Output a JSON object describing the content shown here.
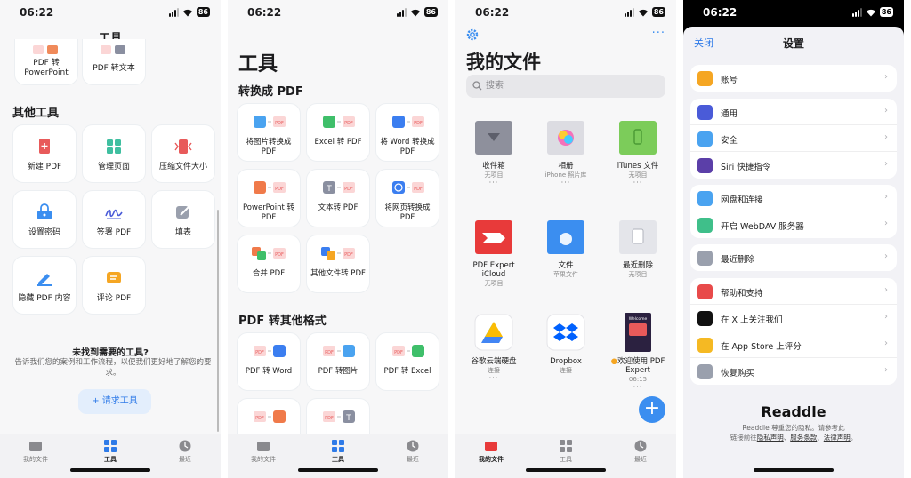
{
  "status": {
    "time": "06:22",
    "battery": "86"
  },
  "tabs": {
    "files": "我的文件",
    "tools": "工具",
    "recent": "最近"
  },
  "panel1": {
    "title": "工具",
    "top_tiles": [
      "PDF 转 PowerPoint",
      "PDF 转文本"
    ],
    "section_title": "其他工具",
    "tools": [
      "新建 PDF",
      "管理页面",
      "压缩文件大小",
      "设置密码",
      "签署 PDF",
      "填表",
      "隐藏 PDF 内容",
      "评论 PDF"
    ],
    "ask_title": "未找到需要的工具?",
    "ask_desc": "告诉我们您的案例和工作流程，以便我们更好地了解您的要求。",
    "request_button": "+ 请求工具"
  },
  "panel2": {
    "title": "工具",
    "section_convert": "转换成 PDF",
    "convert": [
      "将图片转换成 PDF",
      "Excel 转 PDF",
      "将 Word 转换成 PDF",
      "PowerPoint 转 PDF",
      "文本转 PDF",
      "将网页转换成 PDF",
      "合并 PDF",
      "其他文件转 PDF"
    ],
    "section_other": "PDF 转其他格式",
    "export": [
      "PDF 转 Word",
      "PDF 转图片",
      "PDF 转 Excel"
    ]
  },
  "panel3": {
    "title": "我的文件",
    "search_placeholder": "搜索",
    "folders": [
      {
        "name": "收件箱",
        "sub": "无项目"
      },
      {
        "name": "相册",
        "sub": "iPhone 照片库"
      },
      {
        "name": "iTunes 文件",
        "sub": "无项目"
      },
      {
        "name": "PDF Expert iCloud",
        "sub": "无项目"
      },
      {
        "name": "文件",
        "sub": "苹果文件"
      },
      {
        "name": "最近删除",
        "sub": "无项目"
      },
      {
        "name": "谷歌云端硬盘",
        "sub": "连接"
      },
      {
        "name": "Dropbox",
        "sub": "连接"
      },
      {
        "name": "欢迎使用 PDF Expert",
        "sub": "06:15"
      }
    ]
  },
  "panel4": {
    "close": "关闭",
    "title": "设置",
    "rows": [
      "账号",
      "通用",
      "安全",
      "Siri 快捷指令",
      "网盘和连接",
      "开启 WebDAV 服务器",
      "最近删除",
      "帮助和支持",
      "在 X 上关注我们",
      "在 App Store 上评分",
      "恢复购买"
    ],
    "brand": "Readdle",
    "legal_line1": "Readdle 尊重您的隐私。请参考此",
    "legal_prefix": "链接前往",
    "legal_privacy": "隐私声明",
    "legal_terms": "服务条款",
    "legal_law": "法律声明",
    "sep_comma": "、",
    "end_period": "。"
  },
  "colors": {
    "accent": "#2f7be8",
    "pdf_red": "#e85a5a",
    "fab": "#3b8ef0"
  }
}
